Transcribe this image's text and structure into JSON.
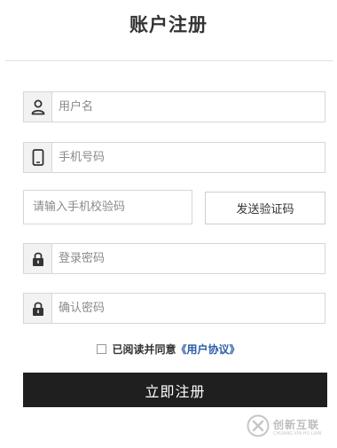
{
  "page": {
    "title": "账户注册"
  },
  "form": {
    "username_placeholder": "用户名",
    "phone_placeholder": "手机号码",
    "code_placeholder": "请输入手机校验码",
    "send_code_label": "发送验证码",
    "login_password_placeholder": "登录密码",
    "confirm_password_placeholder": "确认密码"
  },
  "agreement": {
    "checked": false,
    "prefix": "已阅读并同意",
    "link_text": "《用户协议》"
  },
  "submit": {
    "label": "立即注册"
  },
  "watermark": {
    "brand": "创新互联",
    "sub": "CHUANG XIN HU LIAN"
  },
  "icons": {
    "username": "user-icon",
    "phone": "mobile-phone-icon",
    "login_password": "lock-icon",
    "confirm_password": "lock-icon",
    "watermark": "logo-icon"
  },
  "colors": {
    "submit_bg": "#1f1f1f",
    "link": "#2a5ca8",
    "border": "#d6d6d6",
    "addon_bg": "#f2f2f2"
  }
}
